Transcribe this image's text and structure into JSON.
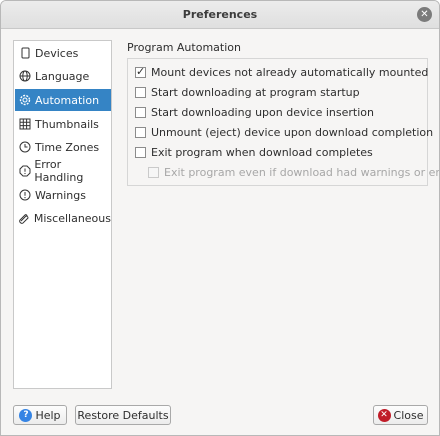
{
  "window": {
    "title": "Preferences"
  },
  "sidebar": {
    "items": [
      {
        "label": "Devices",
        "icon": "device-icon"
      },
      {
        "label": "Language",
        "icon": "globe-icon"
      },
      {
        "label": "Automation",
        "icon": "gear-icon",
        "selected": true
      },
      {
        "label": "Thumbnails",
        "icon": "grid-icon"
      },
      {
        "label": "Time Zones",
        "icon": "clock-icon"
      },
      {
        "label": "Error Handling",
        "icon": "alert-icon"
      },
      {
        "label": "Warnings",
        "icon": "warning-icon"
      },
      {
        "label": "Miscellaneous",
        "icon": "misc-icon"
      }
    ]
  },
  "automation": {
    "section_title": "Program Automation",
    "options": [
      {
        "label": "Mount devices not already automatically mounted",
        "checked": true,
        "enabled": true
      },
      {
        "label": "Start downloading at program startup",
        "checked": false,
        "enabled": true
      },
      {
        "label": "Start downloading upon device insertion",
        "checked": false,
        "enabled": true
      },
      {
        "label": "Unmount (eject) device upon download completion",
        "checked": false,
        "enabled": true
      },
      {
        "label": "Exit program when download completes",
        "checked": false,
        "enabled": true
      },
      {
        "label": "Exit program even if download had warnings or errors",
        "checked": false,
        "enabled": false
      }
    ]
  },
  "buttons": {
    "help": "Help",
    "restore_defaults": "Restore Defaults",
    "close": "Close"
  },
  "colors": {
    "accent": "#3584c5",
    "close_icon": "#c01c28",
    "help_icon": "#3584e4"
  }
}
